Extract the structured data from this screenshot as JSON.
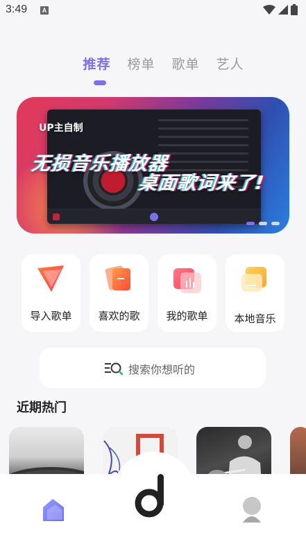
{
  "status": {
    "time": "3:49",
    "badge": "A"
  },
  "tabs": [
    {
      "label": "推荐",
      "active": true
    },
    {
      "label": "榜单",
      "active": false
    },
    {
      "label": "歌单",
      "active": false
    },
    {
      "label": "艺人",
      "active": false
    }
  ],
  "banner": {
    "tag": "UP主自制",
    "line1": "无损音乐播放器",
    "line2": "桌面歌词来了!"
  },
  "quick_actions": [
    {
      "label": "导入歌单",
      "icon": "import-playlist-icon"
    },
    {
      "label": "喜欢的歌",
      "icon": "liked-songs-icon"
    },
    {
      "label": "我的歌单",
      "icon": "my-playlist-icon"
    },
    {
      "label": "本地音乐",
      "icon": "local-music-icon"
    }
  ],
  "search": {
    "placeholder": "搜索你想听的"
  },
  "section": {
    "recent_hot": "近期热门"
  },
  "colors": {
    "accent": "#7b72e9",
    "background": "#f6f6f8"
  },
  "nav": {
    "home_icon": "home-icon",
    "player_icon": "music-note-icon",
    "profile_icon": "profile-icon"
  }
}
